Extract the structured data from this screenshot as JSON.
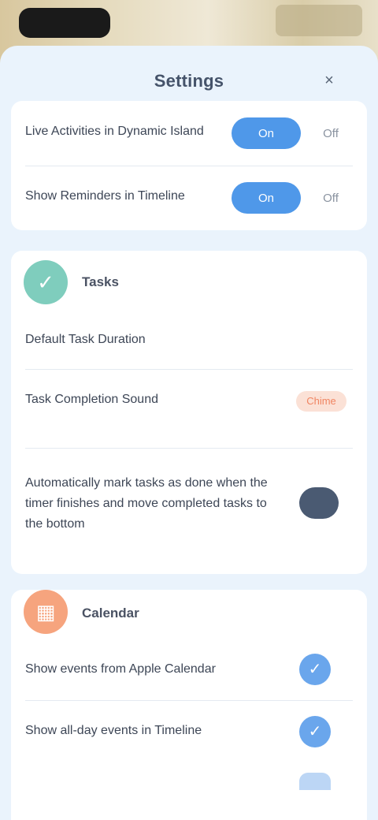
{
  "sheet": {
    "title": "Settings",
    "close_icon": "×"
  },
  "top_card": {
    "rows": [
      {
        "label": "Live Activities in Dynamic Island",
        "on_label": "On",
        "off_label": "Off"
      },
      {
        "label": "Show Reminders in Timeline",
        "on_label": "On",
        "off_label": "Off"
      }
    ]
  },
  "tasks_section": {
    "icon": "✓",
    "title": "Tasks",
    "rows": [
      {
        "label": "Default Task Duration"
      },
      {
        "label": "Task Completion Sound",
        "tag": "Chime"
      },
      {
        "label": "Automatically mark tasks as done when the timer finishes and move completed tasks to the bottom"
      }
    ],
    "accent_color": "#7fcdbd"
  },
  "calendar_section": {
    "icon": "▦",
    "title": "Calendar",
    "rows": [
      {
        "label": "Show events from Apple Calendar",
        "check": "✓"
      },
      {
        "label": "Show all-day events in Timeline",
        "check": "✓"
      }
    ],
    "accent_color": "#f6a47e"
  }
}
